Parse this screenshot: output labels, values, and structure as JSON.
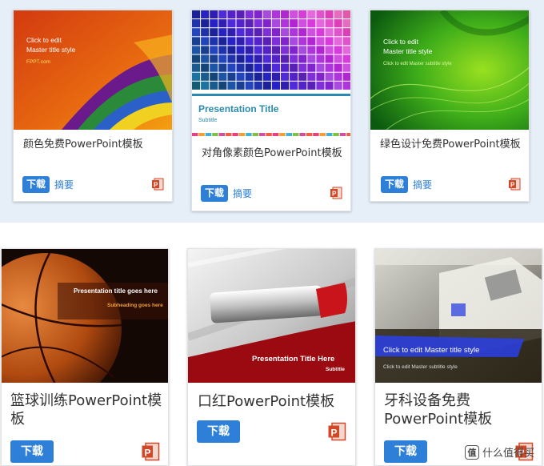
{
  "colors": {
    "accent": "#2d7fd8",
    "band": "#e6eef8",
    "ppt": "#d24726"
  },
  "top_cards": [
    {
      "title": "颜色免费PowerPoint模板",
      "download": "下载",
      "summary": "摘要",
      "icon": "powerpoint-icon",
      "thumb": {
        "line1": "Click to edit",
        "line2": "Master title style",
        "line3": "FPPT.com"
      }
    },
    {
      "title": "对角像素颜色PowerPoint模板",
      "download": "下载",
      "summary": "摘要",
      "icon": "powerpoint-icon",
      "thumb": {
        "line1": "Presentation Title",
        "line2": "Subtitle"
      }
    },
    {
      "title": "绿色设计免费PowerPoint模板",
      "download": "下载",
      "summary": "摘要",
      "icon": "powerpoint-icon",
      "thumb": {
        "line1": "Click to edit",
        "line2": "Master title style",
        "line3": "Click to edit Master subtitle style"
      }
    }
  ],
  "bottom_cards": [
    {
      "title": "篮球训练PowerPoint模板",
      "download": "下载",
      "icon": "powerpoint-icon",
      "thumb": {
        "line1": "Presentation title goes here",
        "line2": "Subheading goes here"
      }
    },
    {
      "title": "口红PowerPoint模板",
      "download": "下载",
      "icon": "powerpoint-icon",
      "thumb": {
        "line1": "Presentation Title Here",
        "line2": "Subtitle"
      }
    },
    {
      "title": "牙科设备免费PowerPoint模板",
      "download": "下载",
      "icon": "powerpoint-icon",
      "thumb": {
        "line1": "Click to edit Master title style",
        "line2": "Click to edit Master subtitle style"
      }
    }
  ],
  "watermark": {
    "badge": "值",
    "text": "什么值得买"
  }
}
